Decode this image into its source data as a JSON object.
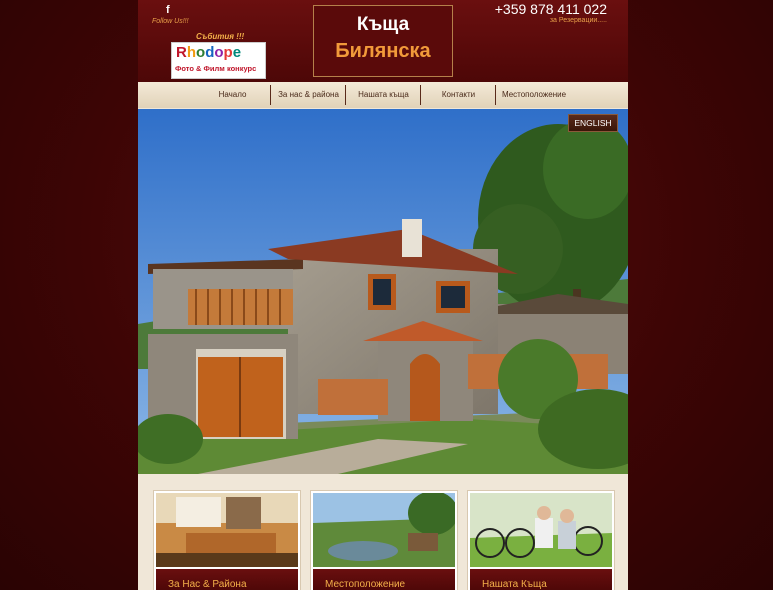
{
  "header": {
    "facebook_icon": "f",
    "follow_text": "Follow Us!!!",
    "events_text": "Събития !!!",
    "promo_logo_word": [
      "R",
      "h",
      "o",
      "d",
      "o",
      "p",
      "e"
    ],
    "promo_subtitle": "Фото & Филм конкурс",
    "title_line1": "Къща",
    "title_line2": "Билянска",
    "phone": "+359 878 411 022",
    "reservation_text": "за Резервации....."
  },
  "nav": {
    "items": [
      "Начало",
      "За нас & района",
      "Нашата къща",
      "Контакти",
      "Местоположение"
    ]
  },
  "hero": {
    "language_button": "ENGLISH"
  },
  "cards": [
    {
      "label": "За Нас & Района"
    },
    {
      "label": "Местоположение"
    },
    {
      "label": "Нашата Къща"
    }
  ],
  "colors": {
    "background": "#3d0505",
    "header": "#5a0a0a",
    "accent": "#f29a3a",
    "nav_bg": "#efe6d8"
  }
}
